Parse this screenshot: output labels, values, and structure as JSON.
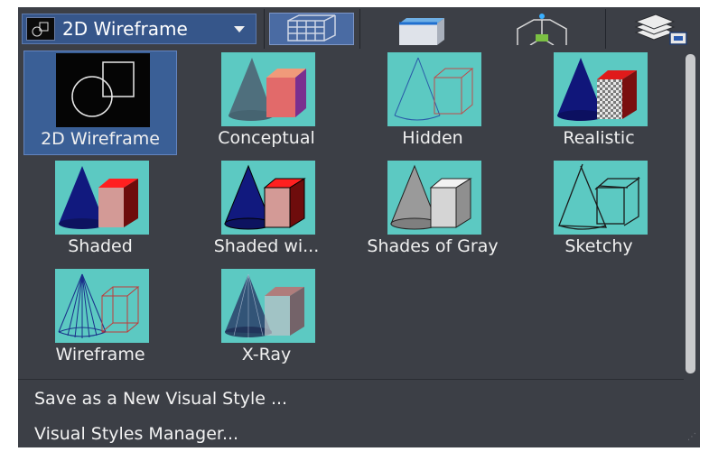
{
  "toolbar": {
    "visual_style_dropdown": {
      "selected": "2D Wireframe"
    },
    "buttons": [
      {
        "name": "grid-view-button",
        "icon": "wireframe-grid-icon"
      },
      {
        "name": "box-view-button",
        "icon": "solid-box-icon"
      },
      {
        "name": "ucs-box-button",
        "icon": "ucs-box-icon"
      },
      {
        "name": "layers-button",
        "icon": "layers-icon"
      }
    ]
  },
  "visual_styles": [
    {
      "label": "2D Wireframe",
      "selected": true
    },
    {
      "label": "Conceptual"
    },
    {
      "label": "Hidden"
    },
    {
      "label": "Realistic"
    },
    {
      "label": "Shaded"
    },
    {
      "label": "Shaded wi..."
    },
    {
      "label": "Shades of Gray"
    },
    {
      "label": "Sketchy"
    },
    {
      "label": "Wireframe"
    },
    {
      "label": "X-Ray"
    }
  ],
  "menu": {
    "save_new_style": "Save as a New Visual Style ...",
    "styles_manager": "Visual Styles Manager..."
  },
  "colors": {
    "panel_bg": "#3c3f46",
    "selection": "#3a5f96",
    "thumbnail_bg": "#5cc9c2"
  }
}
